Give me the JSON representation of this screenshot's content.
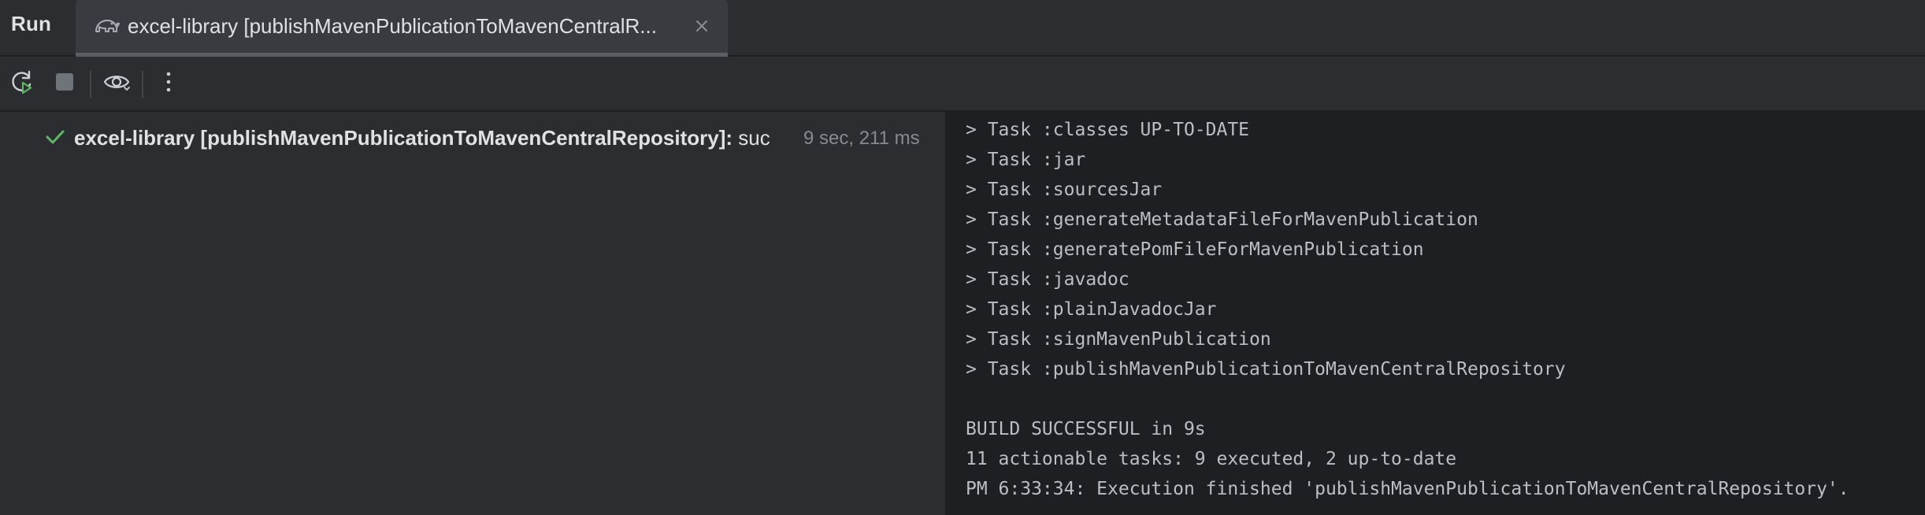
{
  "header": {
    "panel_title": "Run",
    "tab_label": "excel-library [publishMavenPublicationToMavenCentralR...",
    "tab_icon": "gradle-elephant-icon"
  },
  "toolbar": {
    "buttons": [
      {
        "name": "rerun-icon"
      },
      {
        "name": "stop-icon"
      },
      {
        "name": "eye-icon"
      },
      {
        "name": "more-vertical-icon"
      }
    ]
  },
  "tree": {
    "item": {
      "label": "excel-library [publishMavenPublicationToMavenCentralRepository]:",
      "status": " suc",
      "time": "9 sec, 211 ms",
      "status_color": "#5fb865"
    }
  },
  "console": {
    "lines": [
      "> Task :classes UP-TO-DATE",
      "> Task :jar",
      "> Task :sourcesJar",
      "> Task :generateMetadataFileForMavenPublication",
      "> Task :generatePomFileForMavenPublication",
      "> Task :javadoc",
      "> Task :plainJavadocJar",
      "> Task :signMavenPublication",
      "> Task :publishMavenPublicationToMavenCentralRepository",
      "",
      "BUILD SUCCESSFUL in 9s",
      "11 actionable tasks: 9 executed, 2 up-to-date",
      "PM 6:33:34: Execution finished 'publishMavenPublicationToMavenCentralRepository'."
    ]
  },
  "colors": {
    "background": "#2b2d30",
    "console_background": "#1e1f22",
    "success_green": "#5fb865",
    "rerun_green": "#5fb865"
  }
}
